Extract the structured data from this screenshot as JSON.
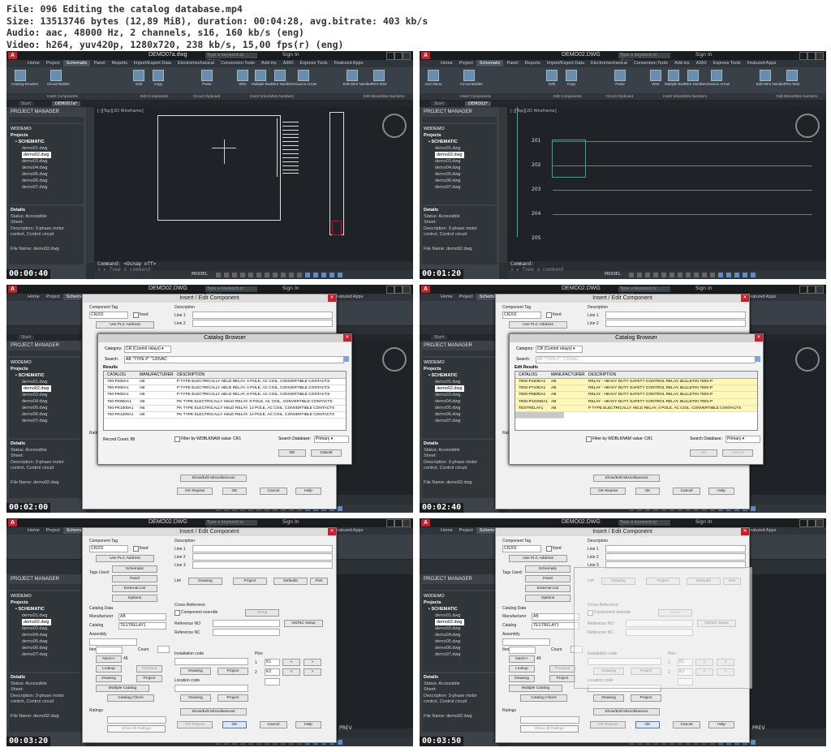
{
  "header": {
    "file": "File: 096 Editing the catalog database.mp4",
    "size": "Size: 13513746 bytes (12,89 MiB), duration: 00:04:28, avg.bitrate: 403 kb/s",
    "audio": "Audio: aac, 48000 Hz, 2 channels, s16, 160 kb/s (eng)",
    "video": "Video: h264, yuv420p, 1280x720, 238 kb/s, 15,00 fps(r) (eng)"
  },
  "app": {
    "logo": "A",
    "search_placeholder": "Type a keyword or phrase",
    "sign_in": "Sign In",
    "tabs": [
      "Home",
      "Project",
      "Schematic",
      "Panel",
      "Reports",
      "Import/Export Data",
      "Electromechanical",
      "Conversion Tools",
      "Add-ins",
      "A360",
      "Express Tools",
      "Featured Apps"
    ],
    "ribbon_buttons": [
      "Catalog Browser",
      "Circuit Builder",
      "Edit",
      "Copy",
      "Paste",
      "Wire",
      "Multiple Bus",
      "Wire Numbers",
      "Source Arrow",
      "Edit Wire Number",
      "Trim Wire"
    ],
    "ribbon_panels": [
      "Insert Components",
      "Edit Components",
      "Circuit Clipboard",
      "Insert Wires/Wire Numbers",
      "Edit Wires/Wire Numbers"
    ],
    "doc_tabs": [
      "Start",
      "DEMO02*"
    ],
    "project_manager": "PROJECT MANAGER",
    "project_name": "WDDEMO",
    "projects_label": "Projects",
    "schematic_label": "SCHEMATIC",
    "files": [
      "demo01.dwg",
      "demo02.dwg",
      "demo03.dwg",
      "demo04.dwg",
      "demo05.dwg",
      "demo06.dwg",
      "demo07.dwg"
    ],
    "details_label": "Details",
    "details": [
      "Status: Accessible",
      "Sheet:",
      "Description: 3-phase motor",
      "control, Control circuit",
      "File Name: demo02.dwg"
    ],
    "model": "MODEL",
    "command_prompt": "Type a command"
  },
  "frames": [
    {
      "title": "DEMO07a.dwg",
      "time": "00:00:40",
      "command": "Command:  <Osnap off>",
      "view": "[-][Top][2D Wireframe]",
      "ribbon_first": "Catalog Browser",
      "doc_tab": "DEMO07a*",
      "ladder": []
    },
    {
      "title": "DEMO02.DWG",
      "time": "00:01:20",
      "command": "Command:",
      "view": "[-][Top][2D Wireframe]",
      "ribbon_first": "Icon Menu",
      "doc_tab": "DEMO02*",
      "ladder": [
        "201",
        "202",
        "203",
        "204",
        "205"
      ]
    },
    {
      "title": "DEMO02.DWG",
      "time": "00:02:00"
    },
    {
      "title": "DEMO02.DWG",
      "time": "00:02:40"
    },
    {
      "title": "DEMO02.DWG",
      "time": "00:03:20"
    },
    {
      "title": "DEMO02.DWG",
      "time": "00:03:50"
    }
  ],
  "insert_dialog": {
    "title": "Insert / Edit Component",
    "component_tag_label": "Component Tag",
    "component_tag": "CR202",
    "fixed": "fixed",
    "use_plc": "Use PLC Address",
    "schematic": "Schematic",
    "panel": "Panel",
    "external_list": "External List",
    "options": "Options",
    "tags_used": "Tags Used:",
    "description": "Description",
    "line1": "Line 1",
    "line2": "Line 2",
    "line3": "Line 3",
    "list": "List",
    "drawing": "Drawing",
    "project": "Project",
    "defaults": "Defaults",
    "pick": "Pick",
    "catalog_data": "Catalog Data",
    "manufacturer_label": "Manufacturer",
    "manufacturer": "AB",
    "catalog_label": "Catalog",
    "catalog": "TESTRELAY1",
    "assembly": "Assembly",
    "item": "Item",
    "count": "Count",
    "next": "Next>>",
    "next_val": "49",
    "lookup": "Lookup",
    "previous": "Previous",
    "multiple_catalog": "Multiple Catalog",
    "catalog_check": "Catalog Check",
    "cross_reference": "Cross-Reference",
    "component_override": "Component override",
    "setup": "Setup",
    "ref_no": "Reference NO",
    "ref_nc": "Reference NC",
    "nonc_setup": "NO/NC Setup",
    "installation_code": "Installation code",
    "location_code": "Location code",
    "pins": "Pins",
    "pin1": "K1",
    "pin2": "K2",
    "ratings": "Ratings",
    "rating": "Rating",
    "show_all_ratings": "Show All Ratings",
    "show_edit_misc": "Show/Edit Miscellaneous",
    "ok_repeat": "OK-Repeat",
    "ok": "OK",
    "cancel": "Cancel",
    "help": "Help",
    "prev": "PREV"
  },
  "catalog_browser": {
    "title": "Catalog Browser",
    "category_label": "Category:",
    "category": "CR (Control relays)",
    "search_label": "Search:",
    "search": "AB \"TYPE P\" \"120VAC",
    "results": "Results",
    "edit_results": "Edit Results",
    "columns": [
      "CATALOG",
      "MANUFACTURER",
      "DESCRIPTION"
    ],
    "rows": [
      [
        "700-P200A1",
        "AB",
        "P TYPE ELECTRICALLY HELD RELAY, 4 POLE, AC COIL, CONVERTIBLE CONTACTS"
      ],
      [
        "700-P400A1",
        "AB",
        "P TYPE ELECTRICALLY HELD RELAY, 4 POLE, AC COIL, CONVERTIBLE CONTACTS"
      ],
      [
        "700-P600A1",
        "AB",
        "P TYPE ELECTRICALLY HELD RELAY, 8 POLE, AC COIL, CONVERTIBLE CONTACTS"
      ],
      [
        "700-PK800A1",
        "AB",
        "PK TYPE ELECTRICALLY HELD RELAY, 8 POLE, AC COIL, CONVERTIBLE CONTACTS"
      ],
      [
        "700-PK1000A1",
        "AB",
        "PK TYPE ELECTRICALLY HELD RELAY, 12 POLE, AC COIL, CONVERTIBLE CONTACTS"
      ],
      [
        "700-PK1200A1",
        "AB",
        "PK TYPE ELECTRICALLY HELD RELAY, 12 POLE, AC COIL, CONVERTIBLE CONTACTS"
      ]
    ],
    "edit_rows": [
      [
        "700S-P220DA1",
        "AB",
        "RELAY - HEAVY DUTY SAFETY CONTROL RELAY, BULLETIN  700S-P"
      ],
      [
        "700S-P710DA1",
        "AB",
        "RELAY - HEAVY DUTY SAFETY CONTROL RELAY, BULLETIN  700S-P"
      ],
      [
        "700S-P550DA1",
        "AB",
        "RELAY - HEAVY DUTY SAFETY CONTROL RELAY, BULLETIN  700S-P"
      ],
      [
        "700S-P1020DA1",
        "AB",
        "RELAY - HEAVY DUTY SAFETY CONTROL RELAY, BULLETIN  700S-P"
      ],
      [
        "TESTRELAY1",
        "AB",
        "P TYPE ELECTRICALLY HELD RELAY, 4 POLE, AC COIL, CONVERTIBLE CONTACTS"
      ]
    ],
    "record_count": "Record Count: 88",
    "filter": "Filter by WDBLKNAM value: CR1",
    "search_db_label": "Search Database:",
    "search_db": "Primary",
    "ok": "OK",
    "cancel": "Cancel"
  }
}
